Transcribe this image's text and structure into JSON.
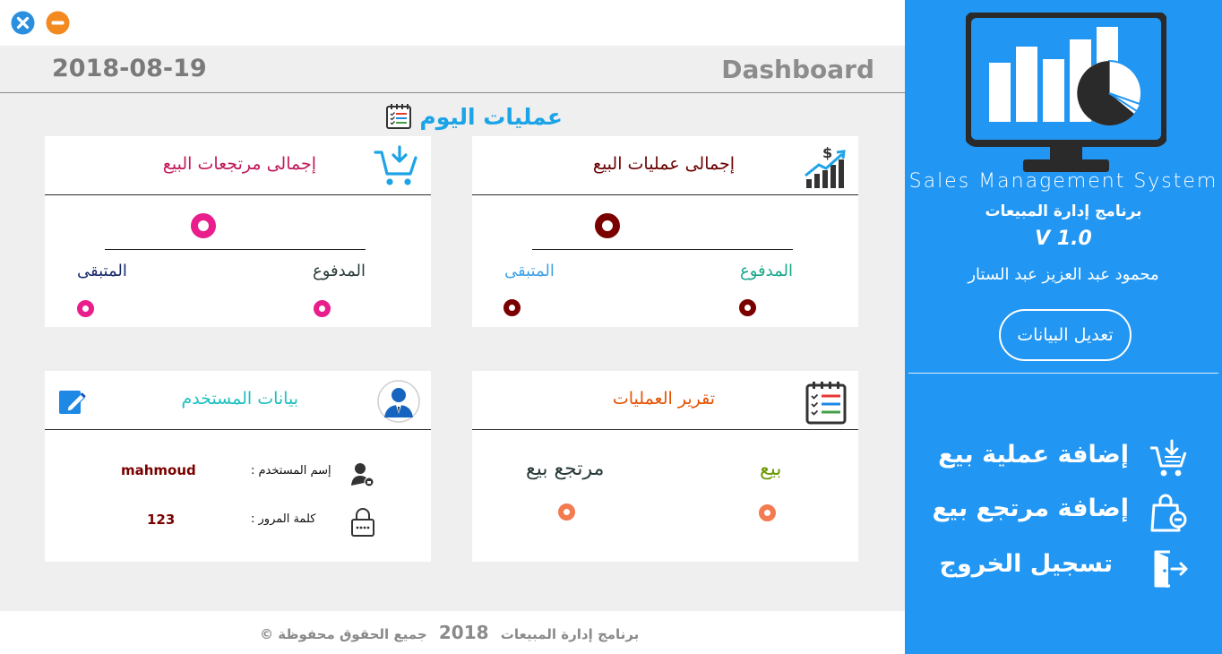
{
  "window": {
    "close_icon": "close-circle-icon",
    "minimize_icon": "minimize-circle-icon",
    "colors": {
      "close": "#2b8fe0",
      "minimize": "#f28a1f"
    }
  },
  "header": {
    "date": "2018-08-19",
    "title": "Dashboard"
  },
  "today_section": {
    "label": "عمليات اليوم",
    "icon": "checklist-icon"
  },
  "cards": {
    "sales_total": {
      "title": "إجمالى عمليات البيع",
      "icon": "sales-chart-icon",
      "paid_label": "المدفوع",
      "remaining_label": "المتبقى",
      "color": "#7a0000"
    },
    "returns_total": {
      "title": "إجمالى مرتجعات البيع",
      "icon": "cart-download-icon",
      "paid_label": "المدفوع",
      "remaining_label": "المتبقى",
      "color": "#e91e8c"
    },
    "report": {
      "title": "تقرير العمليات",
      "icon": "report-checklist-icon",
      "sale_label": "بيع",
      "return_label": "مرتجع بيع",
      "color": "#f47a50"
    },
    "user": {
      "title": "بيانات المستخدم",
      "icon": "user-avatar-icon",
      "edit_icon": "edit-pencil-icon",
      "username_label": "إسم المستخدم :",
      "username_value": "mahmoud",
      "password_label": "كلمة المرور :",
      "password_value": "123"
    }
  },
  "footer": {
    "rights": "جميع الحقوق محفوظة",
    "year": "2018",
    "copyright": "© برنامج إدارة المبيعات"
  },
  "sidebar": {
    "logo_icon": "monitor-chart-logo-icon",
    "app_name_en": "Sales Management System",
    "app_name_ar": "برنامج إدارة المبيعات",
    "version": "V 1.0",
    "author": "محمود عبد العزيز عبد الستار",
    "edit_button": "تعديل البيانات",
    "nav": [
      {
        "label": "إضافة عملية بيع",
        "icon": "cart-add-icon"
      },
      {
        "label": "إضافة مرتجع بيع",
        "icon": "shopping-bag-return-icon"
      },
      {
        "label": "تسجيل الخروج",
        "icon": "logout-door-icon"
      }
    ],
    "colors": {
      "background": "#2196f3"
    }
  }
}
